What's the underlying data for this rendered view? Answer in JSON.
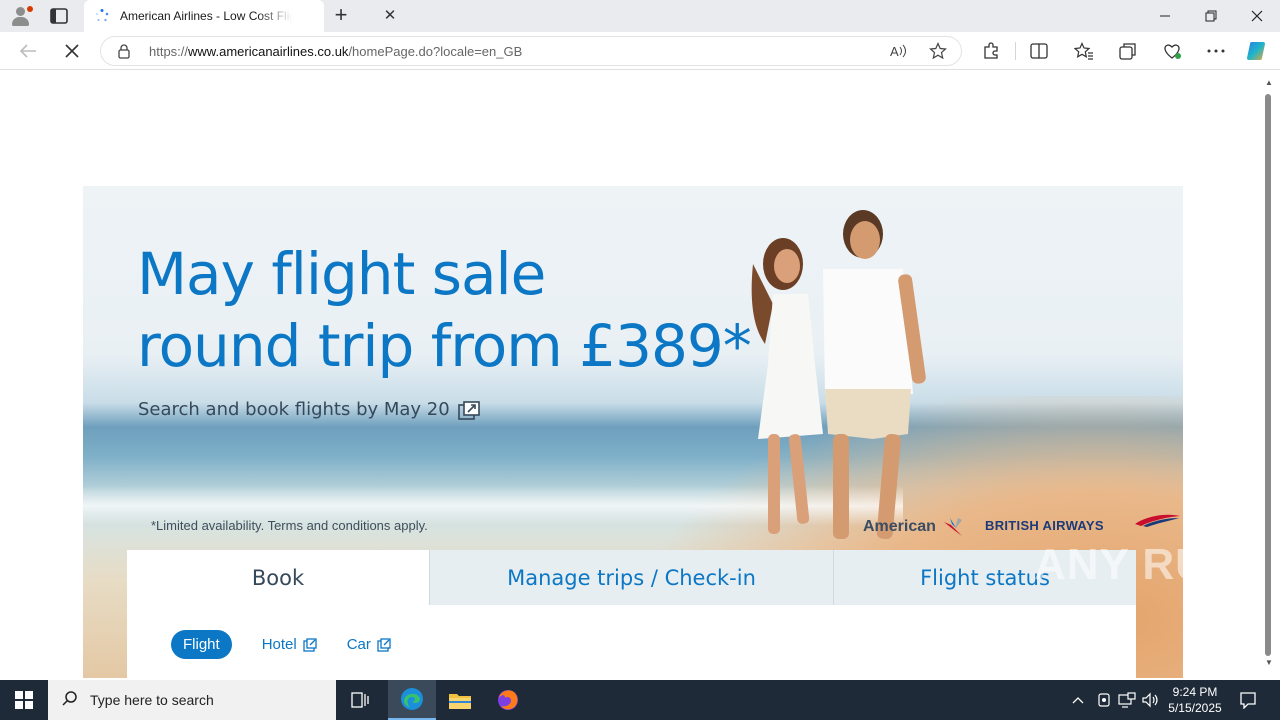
{
  "browser": {
    "tab_title": "American Airlines - Low Cost Flig",
    "url_prefix": "https://",
    "url_host": "www.americanairlines.co.uk",
    "url_path": "/homePage.do?locale=en_GB"
  },
  "hero": {
    "headline_line1": "May flight sale",
    "headline_line2": "round trip from £389*",
    "subline": "Search and book flights by May 20",
    "disclaimer": "*Limited availability. Terms and conditions apply.",
    "logo_american": "American",
    "logo_ba": "BRITISH AIRWAYS"
  },
  "booking": {
    "tabs": [
      {
        "label": "Book"
      },
      {
        "label": "Manage trips / Check-in"
      },
      {
        "label": "Flight status"
      }
    ],
    "modes": [
      {
        "label": "Flight"
      },
      {
        "label": "Hotel"
      },
      {
        "label": "Car"
      }
    ]
  },
  "watermark": "ANY RUN",
  "taskbar": {
    "search_placeholder": "Type here to search",
    "time": "9:24 PM",
    "date": "5/15/2025"
  },
  "colors": {
    "brand_blue": "#0b77c5",
    "taskbar": "#1e2a38"
  }
}
